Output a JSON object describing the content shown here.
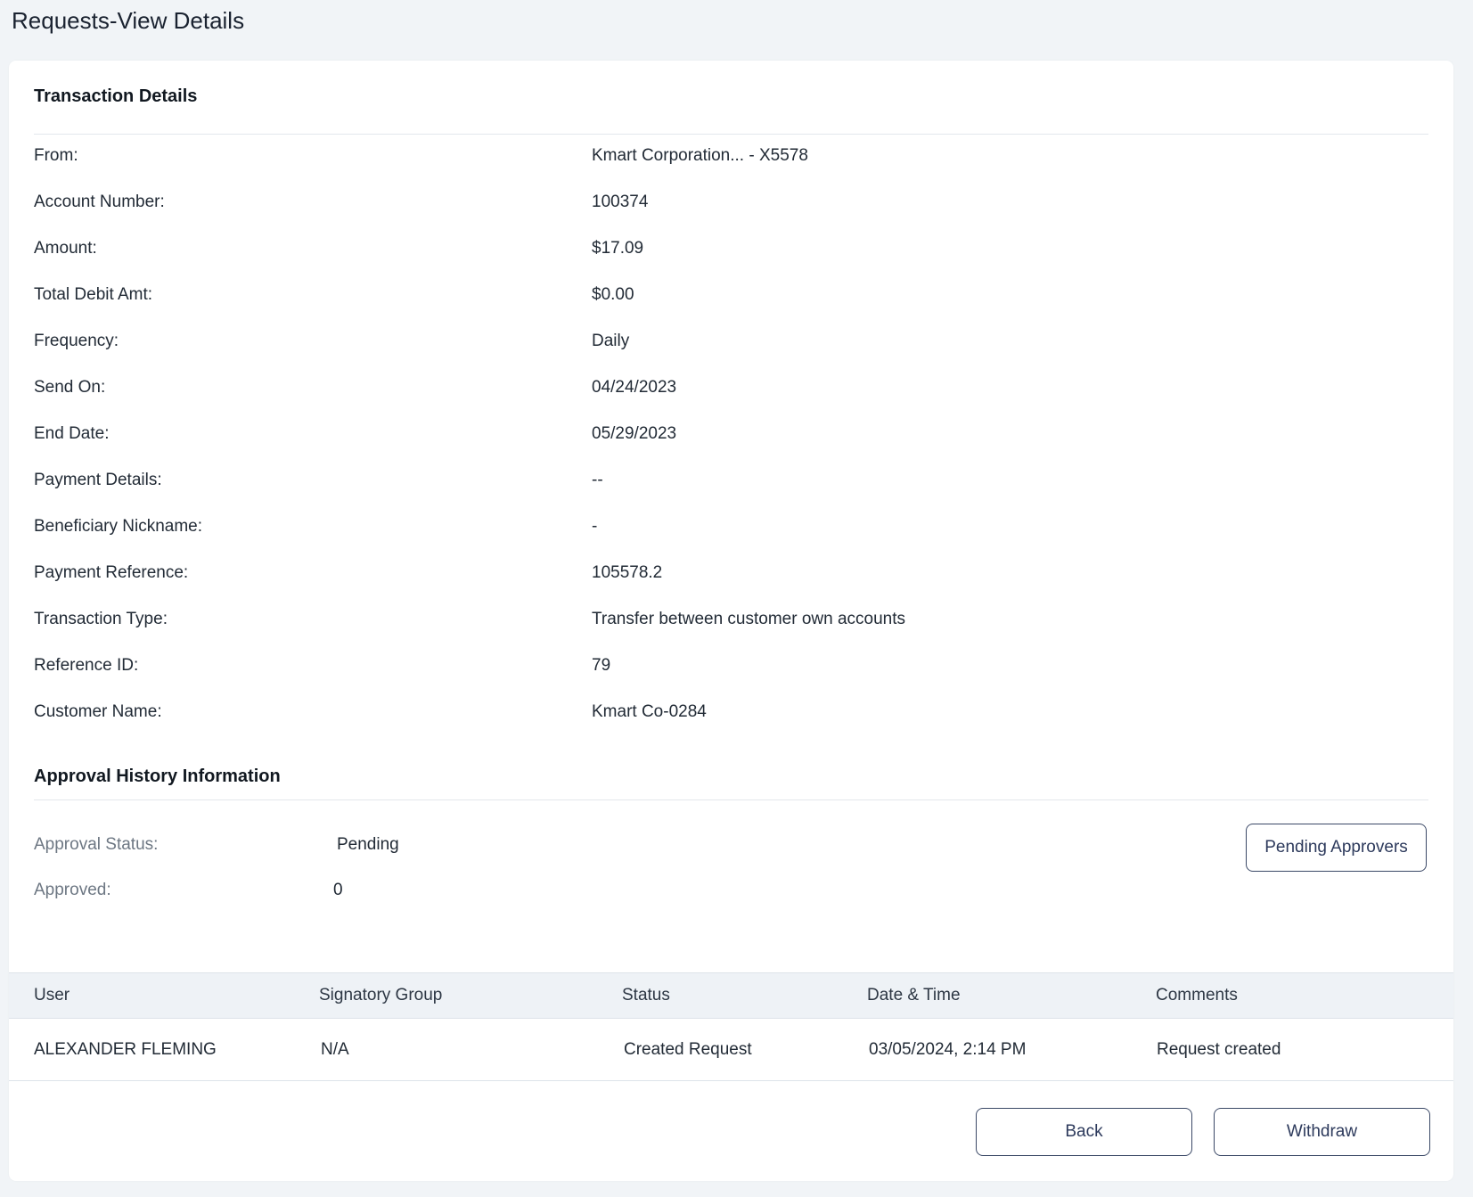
{
  "page": {
    "title": "Requests-View Details"
  },
  "transaction": {
    "section_title": "Transaction Details",
    "fields": [
      {
        "label": "From:",
        "value": "Kmart Corporation... - X5578"
      },
      {
        "label": "Account Number:",
        "value": "100374"
      },
      {
        "label": "Amount:",
        "value": "$17.09"
      },
      {
        "label": "Total Debit Amt:",
        "value": "$0.00"
      },
      {
        "label": "Frequency:",
        "value": "Daily"
      },
      {
        "label": "Send On:",
        "value": "04/24/2023"
      },
      {
        "label": "End Date:",
        "value": "05/29/2023"
      },
      {
        "label": "Payment Details:",
        "value": "--"
      },
      {
        "label": "Beneficiary Nickname:",
        "value": "-"
      },
      {
        "label": "Payment Reference:",
        "value": "105578.2"
      },
      {
        "label": "Transaction Type:",
        "value": "Transfer between customer own accounts"
      },
      {
        "label": "Reference ID:",
        "value": "79"
      },
      {
        "label": "Customer Name:",
        "value": "Kmart Co-0284"
      }
    ]
  },
  "approval": {
    "section_title": "Approval History Information",
    "status_label": "Approval Status:",
    "status_value": "Pending",
    "approved_label": "Approved:",
    "approved_value": "0",
    "pending_approvers_button": "Pending Approvers"
  },
  "history_table": {
    "columns": [
      "User",
      "Signatory Group",
      "Status",
      "Date & Time",
      "Comments"
    ],
    "rows": [
      [
        "ALEXANDER FLEMING",
        "N/A",
        "Created Request",
        "03/05/2024, 2:14 PM",
        "Request created"
      ]
    ]
  },
  "actions": {
    "back": "Back",
    "withdraw": "Withdraw"
  }
}
